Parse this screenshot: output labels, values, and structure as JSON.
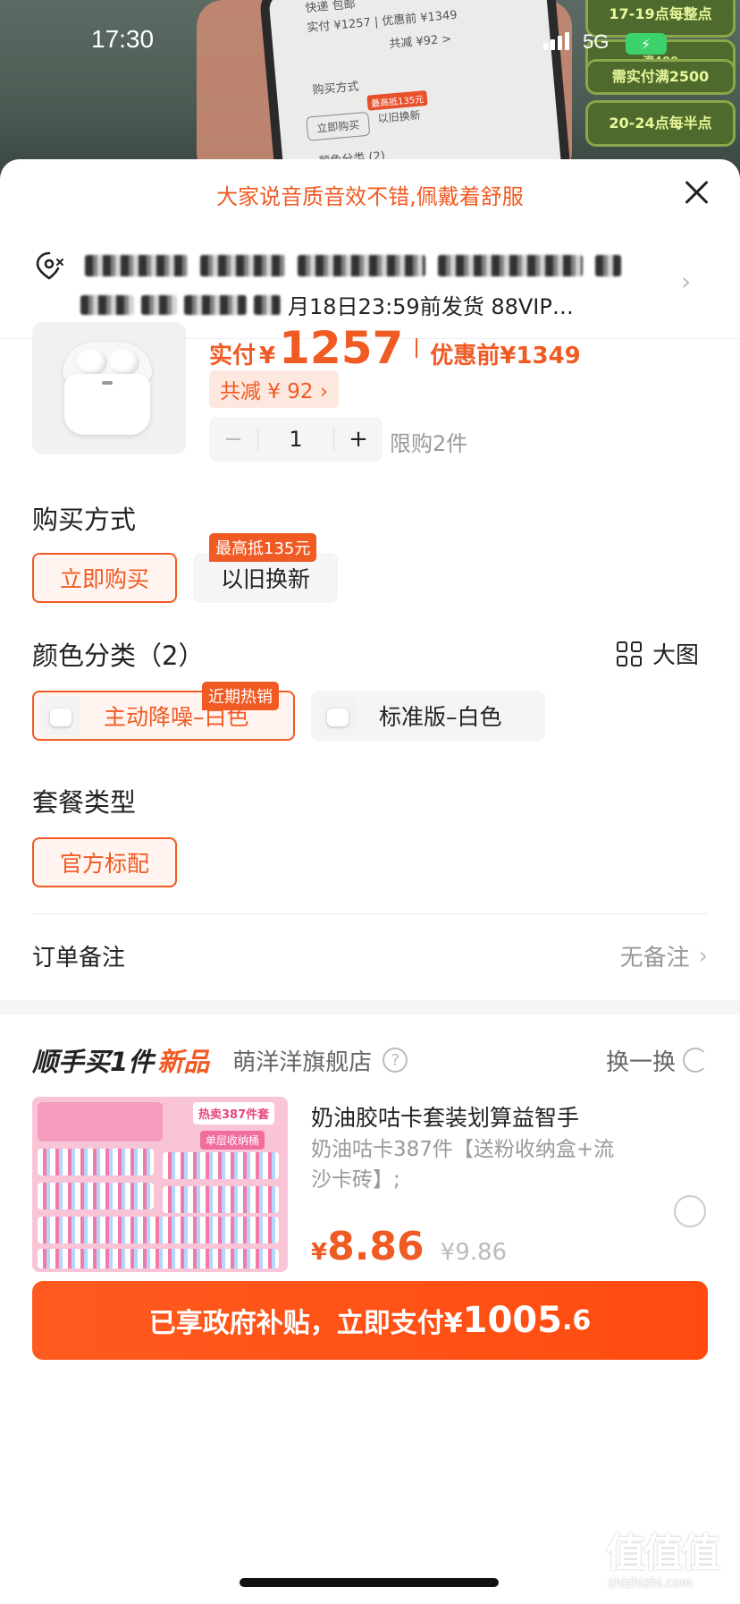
{
  "status_bar": {
    "time": "17:30",
    "network": "5G"
  },
  "background": {
    "phone_lines": [
      "快递 包邮",
      "实付 ¥1257 | 优惠前 ¥1349",
      "共减 ¥92 >",
      "购买方式",
      "立即购买",
      "以旧换新",
      "最高抵135元",
      "颜色分类 (2)"
    ],
    "promos": [
      {
        "title": "17-19点每整点",
        "sub": ""
      },
      {
        "title": "",
        "sub": "满400"
      },
      {
        "title": "需实付满2500",
        "sub": ""
      },
      {
        "title": "20-24点每半点",
        "sub": ""
      }
    ]
  },
  "sheet": {
    "tip": "大家说音质音效不错,佩戴着舒服",
    "address_line2": "月18日23:59前发货 88VIP…",
    "price": {
      "paid_label": "实付",
      "currency": "¥",
      "paid_value": "1257",
      "orig_label": "优惠前",
      "orig_value": "¥1349",
      "save_label": "共减 ¥ 92 ›"
    },
    "stepper": {
      "minus": "−",
      "qty": "1",
      "plus": "+",
      "limit": "限购2件"
    },
    "purchase_method": {
      "title": "购买方式",
      "options": [
        "立即购买",
        "以旧换新"
      ],
      "badge": "最高抵135元"
    },
    "color": {
      "title": "颜色分类（2）",
      "big_view": "大图",
      "options": [
        "主动降噪–白色",
        "标准版–白色"
      ],
      "badge": "近期热销"
    },
    "package": {
      "title": "套餐类型",
      "options": [
        "官方标配"
      ]
    },
    "note": {
      "label": "订单备注",
      "value": "无备注"
    },
    "recommend": {
      "title_a": "顺手买1件",
      "title_b": "新品",
      "shop": "萌洋洋旗舰店",
      "help": "?",
      "swap": "换一换",
      "item_title": "奶油胶咕卡套装划算益智手",
      "item_desc": "奶油咕卡387件【送粉收纳盒+流沙卡砖】;",
      "img_hot": "热卖387件套",
      "img_store": "单层收纳桶",
      "price_currency": "¥",
      "price_value": "8.86",
      "price_orig": "¥9.86"
    },
    "pay_button": {
      "text": "已享政府补贴，立即支付¥",
      "amount": "1005",
      "decimals": ".6"
    }
  },
  "watermark": {
    "logo": "值值值",
    "site": "zhizhizhi.com"
  },
  "colors": {
    "accent": "#f05a23",
    "pay": "#ff4b0f"
  }
}
